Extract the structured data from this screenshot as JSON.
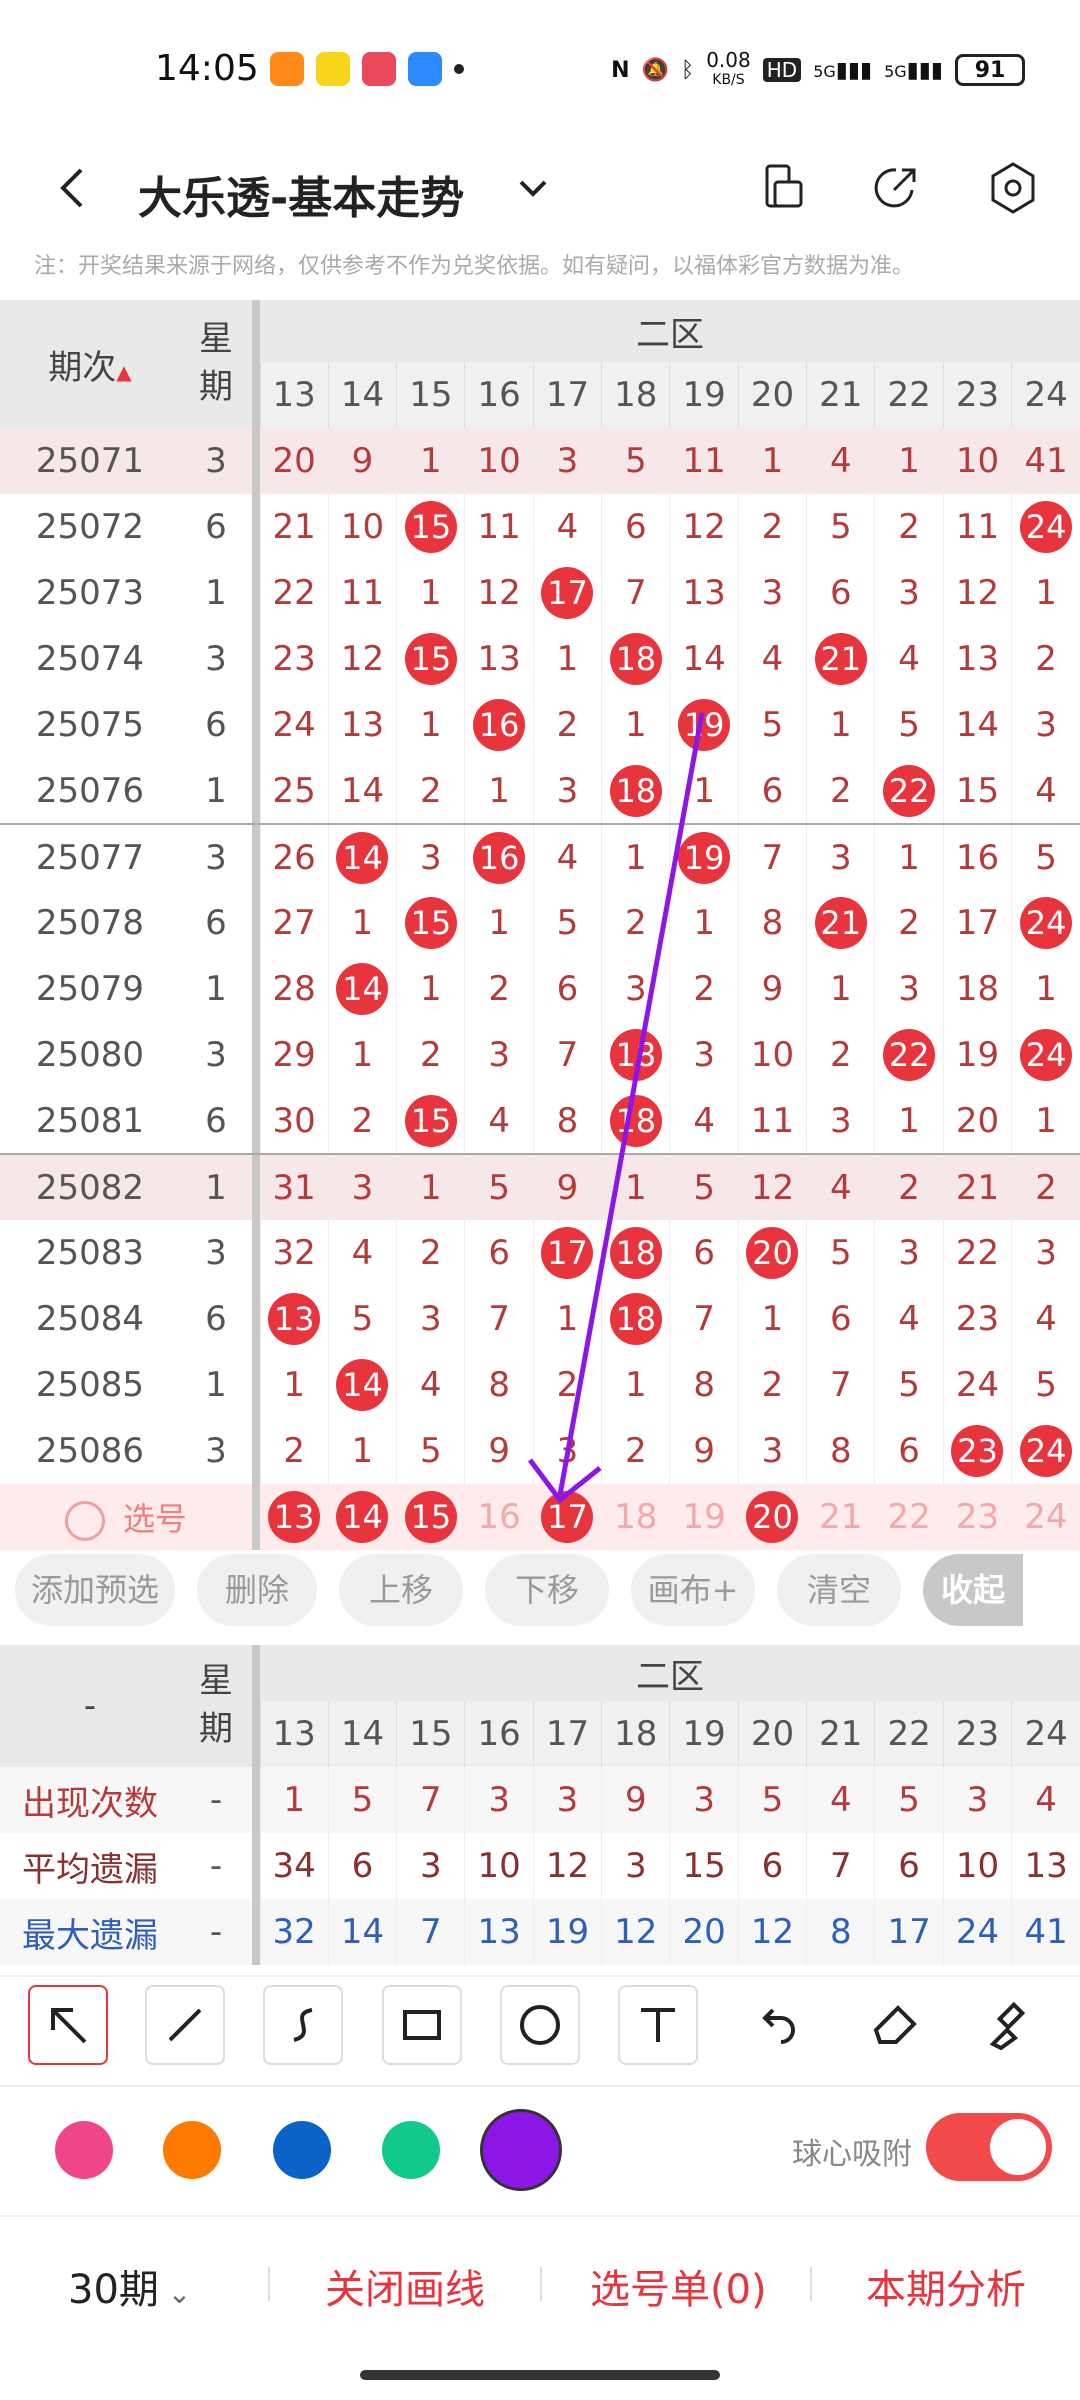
{
  "status_bar": {
    "time": "14:05",
    "net_speed_value": "0.08",
    "net_speed_unit": "KB/S",
    "hd": "HD",
    "net1": "5G",
    "net2": "5G",
    "battery": "91"
  },
  "header": {
    "title": "大乐透-基本走势"
  },
  "note": "注：开奖结果来源于网络，仅供参考不作为兑奖依据。如有疑问，以福体彩官方数据为准。",
  "table": {
    "issue_label": "期次",
    "week_label": [
      "星",
      "期"
    ],
    "zone_label": "二区",
    "columns": [
      "13",
      "14",
      "15",
      "16",
      "17",
      "18",
      "19",
      "20",
      "21",
      "22",
      "23",
      "24"
    ],
    "rows": [
      {
        "issue": "25071",
        "week": "3",
        "cells": [
          "20",
          "9",
          "1",
          "10",
          "3",
          "5",
          "11",
          "1",
          "4",
          "1",
          "10",
          "41"
        ],
        "hits": []
      },
      {
        "issue": "25072",
        "week": "6",
        "cells": [
          "21",
          "10",
          "15",
          "11",
          "4",
          "6",
          "12",
          "2",
          "5",
          "2",
          "11",
          "24"
        ],
        "hits": [
          2,
          11
        ]
      },
      {
        "issue": "25073",
        "week": "1",
        "cells": [
          "22",
          "11",
          "1",
          "12",
          "17",
          "7",
          "13",
          "3",
          "6",
          "3",
          "12",
          "1"
        ],
        "hits": [
          4
        ]
      },
      {
        "issue": "25074",
        "week": "3",
        "cells": [
          "23",
          "12",
          "15",
          "13",
          "1",
          "18",
          "14",
          "4",
          "21",
          "4",
          "13",
          "2"
        ],
        "hits": [
          2,
          5,
          8
        ]
      },
      {
        "issue": "25075",
        "week": "6",
        "cells": [
          "24",
          "13",
          "1",
          "16",
          "2",
          "1",
          "19",
          "5",
          "1",
          "5",
          "14",
          "3"
        ],
        "hits": [
          3,
          6
        ]
      },
      {
        "issue": "25076",
        "week": "1",
        "cells": [
          "25",
          "14",
          "2",
          "1",
          "3",
          "18",
          "1",
          "6",
          "2",
          "22",
          "15",
          "4"
        ],
        "hits": [
          5,
          9
        ]
      },
      {
        "issue": "25077",
        "week": "3",
        "cells": [
          "26",
          "14",
          "3",
          "16",
          "4",
          "1",
          "19",
          "7",
          "3",
          "1",
          "16",
          "5"
        ],
        "hits": [
          1,
          3,
          6
        ]
      },
      {
        "issue": "25078",
        "week": "6",
        "cells": [
          "27",
          "1",
          "15",
          "1",
          "5",
          "2",
          "1",
          "8",
          "21",
          "2",
          "17",
          "24"
        ],
        "hits": [
          2,
          8,
          11
        ]
      },
      {
        "issue": "25079",
        "week": "1",
        "cells": [
          "28",
          "14",
          "1",
          "2",
          "6",
          "3",
          "2",
          "9",
          "1",
          "3",
          "18",
          "1"
        ],
        "hits": [
          1
        ]
      },
      {
        "issue": "25080",
        "week": "3",
        "cells": [
          "29",
          "1",
          "2",
          "3",
          "7",
          "18",
          "3",
          "10",
          "2",
          "22",
          "19",
          "24"
        ],
        "hits": [
          5,
          9,
          11
        ]
      },
      {
        "issue": "25081",
        "week": "6",
        "cells": [
          "30",
          "2",
          "15",
          "4",
          "8",
          "18",
          "4",
          "11",
          "3",
          "1",
          "20",
          "1"
        ],
        "hits": [
          2,
          5
        ]
      },
      {
        "issue": "25082",
        "week": "1",
        "cells": [
          "31",
          "3",
          "1",
          "5",
          "9",
          "1",
          "5",
          "12",
          "4",
          "2",
          "21",
          "2"
        ],
        "hits": []
      },
      {
        "issue": "25083",
        "week": "3",
        "cells": [
          "32",
          "4",
          "2",
          "6",
          "17",
          "18",
          "6",
          "20",
          "5",
          "3",
          "22",
          "3"
        ],
        "hits": [
          4,
          5,
          7
        ]
      },
      {
        "issue": "25084",
        "week": "6",
        "cells": [
          "13",
          "5",
          "3",
          "7",
          "1",
          "18",
          "7",
          "1",
          "6",
          "4",
          "23",
          "4"
        ],
        "hits": [
          0,
          5
        ]
      },
      {
        "issue": "25085",
        "week": "1",
        "cells": [
          "1",
          "14",
          "4",
          "8",
          "2",
          "1",
          "8",
          "2",
          "7",
          "5",
          "24",
          "5"
        ],
        "hits": [
          1
        ]
      },
      {
        "issue": "25086",
        "week": "3",
        "cells": [
          "2",
          "1",
          "5",
          "9",
          "3",
          "2",
          "9",
          "3",
          "8",
          "6",
          "23",
          "24"
        ],
        "hits": [
          10,
          11
        ]
      }
    ],
    "select_row": {
      "label": "选号",
      "cells": [
        "13",
        "14",
        "15",
        "16",
        "17",
        "18",
        "19",
        "20",
        "21",
        "22",
        "23",
        "24"
      ],
      "selected": [
        0,
        1,
        2,
        4,
        7
      ]
    }
  },
  "actions": [
    "添加预选",
    "删除",
    "上移",
    "下移",
    "画布+",
    "清空",
    "收起"
  ],
  "stats": {
    "header_label": "-",
    "week_label": [
      "星",
      "期"
    ],
    "zone_label": "二区",
    "columns": [
      "13",
      "14",
      "15",
      "16",
      "17",
      "18",
      "19",
      "20",
      "21",
      "22",
      "23",
      "24"
    ],
    "rows": [
      {
        "label": "出现次数",
        "dash": "-",
        "values": [
          "1",
          "5",
          "7",
          "3",
          "3",
          "9",
          "3",
          "5",
          "4",
          "5",
          "3",
          "4"
        ],
        "color": "#b53a3a"
      },
      {
        "label": "平均遗漏",
        "dash": "-",
        "values": [
          "34",
          "6",
          "3",
          "10",
          "12",
          "3",
          "15",
          "6",
          "7",
          "6",
          "10",
          "13"
        ],
        "color": "#8a3030"
      },
      {
        "label": "最大遗漏",
        "dash": "-",
        "values": [
          "32",
          "14",
          "7",
          "13",
          "19",
          "12",
          "20",
          "12",
          "8",
          "17",
          "24",
          "41"
        ],
        "color": "#2f5fb8"
      }
    ]
  },
  "tools": [
    "arrow-tool",
    "line-tool",
    "curve-tool",
    "rect-tool",
    "circle-tool",
    "text-tool",
    "undo-tool",
    "eraser-tool",
    "clear-tool"
  ],
  "colors": [
    "#f0468a",
    "#ff7a00",
    "#0b62c9",
    "#12c98c",
    "#8c16e6"
  ],
  "snap_label": "球心吸附",
  "bottom": {
    "periods": "30期",
    "close_draw": "关闭画线",
    "pick_list": "选号单(0)",
    "analysis": "本期分析"
  }
}
